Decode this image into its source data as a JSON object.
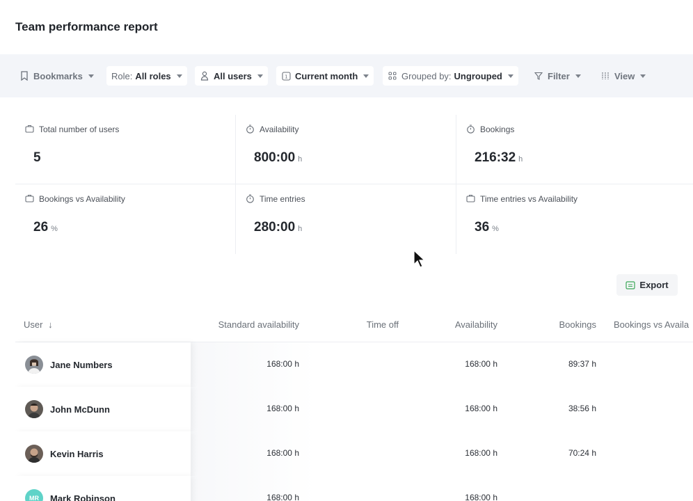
{
  "page": {
    "title": "Team performance report"
  },
  "toolbar": {
    "bookmarks": {
      "label": "Bookmarks",
      "icon": "bookmark-icon"
    },
    "role": {
      "prefix": "Role:",
      "value": "All roles"
    },
    "users": {
      "label": "All users",
      "icon": "user-icon"
    },
    "period": {
      "label": "Current month",
      "icon": "calendar-icon",
      "icon_text": "1"
    },
    "grouping": {
      "prefix": "Grouped by:",
      "value": "Ungrouped",
      "icon": "grid-icon"
    },
    "filter": {
      "label": "Filter",
      "icon": "filter-icon"
    },
    "view": {
      "label": "View",
      "icon": "sliders-icon"
    }
  },
  "stats": [
    {
      "label": "Total number of users",
      "value": "5",
      "unit": "",
      "icon": "briefcase-icon"
    },
    {
      "label": "Availability",
      "value": "800:00",
      "unit": "h",
      "icon": "stopwatch-icon"
    },
    {
      "label": "Bookings",
      "value": "216:32",
      "unit": "h",
      "icon": "stopwatch-icon"
    },
    {
      "label": "Bookings vs Availability",
      "value": "26",
      "unit": "%",
      "icon": "briefcase-icon"
    },
    {
      "label": "Time entries",
      "value": "280:00",
      "unit": "h",
      "icon": "stopwatch-icon"
    },
    {
      "label": "Time entries vs Availability",
      "value": "36",
      "unit": "%",
      "icon": "briefcase-icon"
    }
  ],
  "export": {
    "label": "Export",
    "icon": "csv-icon"
  },
  "table": {
    "columns": [
      "User",
      "Standard availability",
      "Time off",
      "Availability",
      "Bookings",
      "Bookings vs Availa"
    ],
    "sort_icon": "sort-down-icon",
    "rows": [
      {
        "name": "Jane Numbers",
        "initials": "",
        "avatar_color": "#8a8f96",
        "standard": "168:00 h",
        "time_off": "",
        "availability": "168:00 h",
        "bookings": "89:37 h"
      },
      {
        "name": "John McDunn",
        "initials": "",
        "avatar_color": "#5f5a55",
        "standard": "168:00 h",
        "time_off": "",
        "availability": "168:00 h",
        "bookings": "38:56 h"
      },
      {
        "name": "Kevin Harris",
        "initials": "",
        "avatar_color": "#6b5f57",
        "standard": "168:00 h",
        "time_off": "",
        "availability": "168:00 h",
        "bookings": "70:24 h"
      },
      {
        "name": "Mark Robinson",
        "initials": "MR",
        "avatar_color": "#5fd3c8",
        "standard": "168:00 h",
        "time_off": "",
        "availability": "168:00 h",
        "bookings": ""
      }
    ]
  },
  "colors": {
    "toolbar_bg": "#f3f5f9",
    "accent_csv": "#3aa757"
  }
}
